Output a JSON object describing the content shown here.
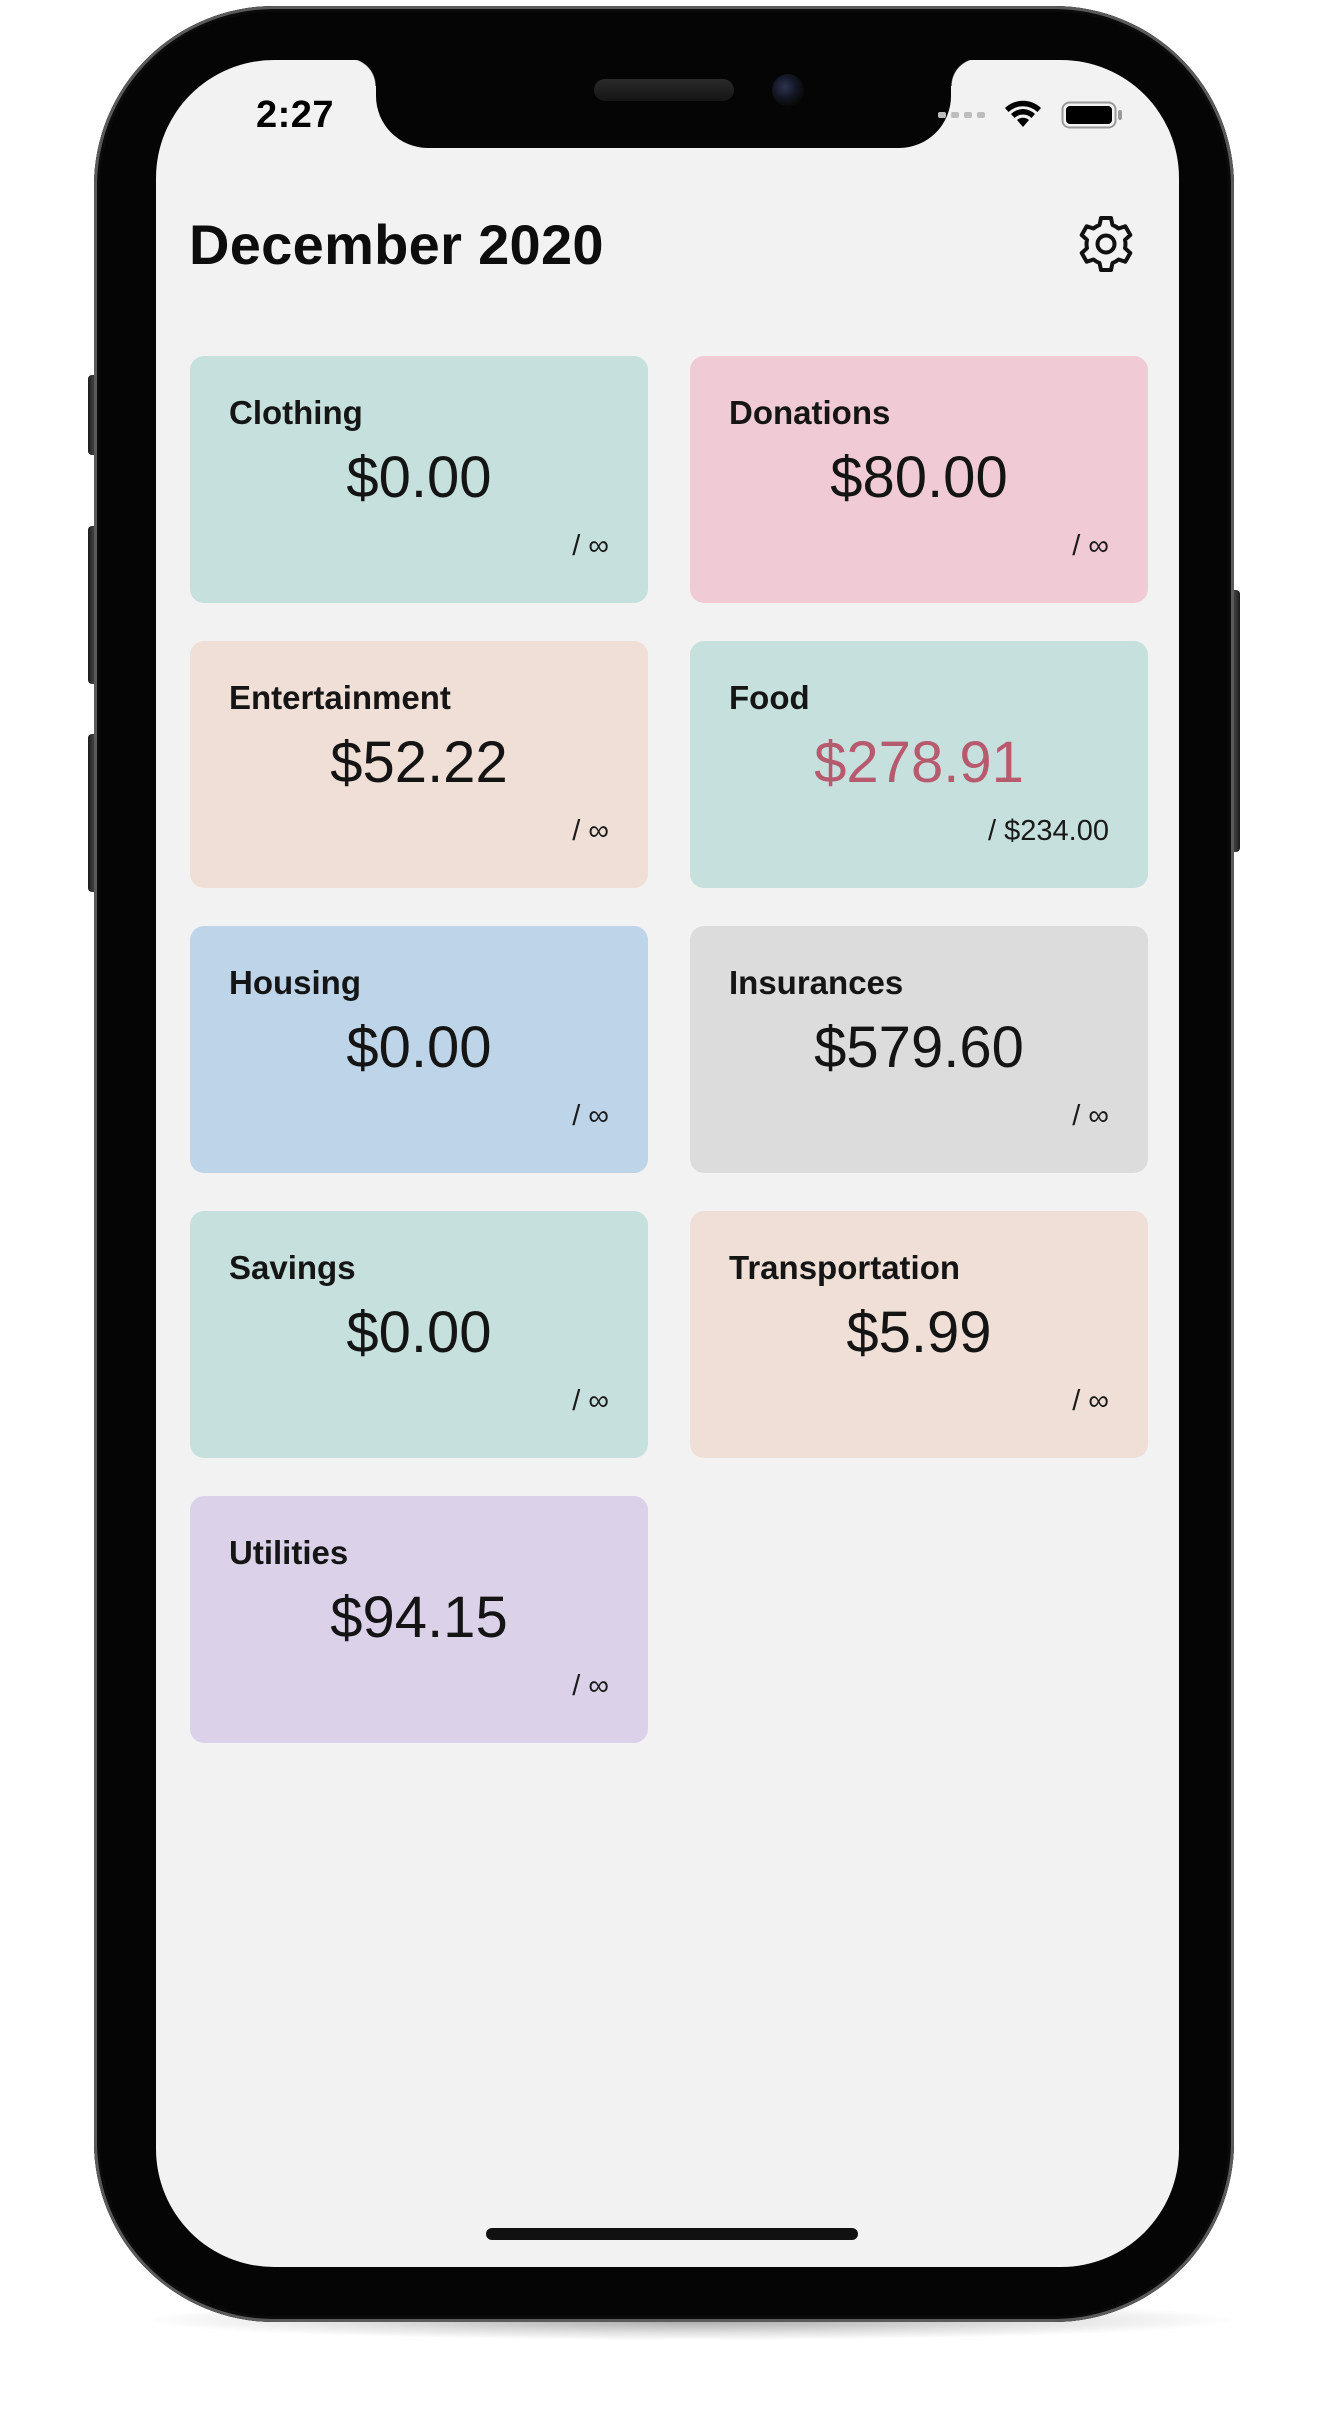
{
  "status_bar": {
    "time": "2:27",
    "icons": [
      "signal-dots-icon",
      "wifi-icon",
      "battery-icon"
    ]
  },
  "header": {
    "title": "December 2020",
    "settings_icon": "gear-icon"
  },
  "colors": {
    "screen_bg": "#f2f2f2",
    "over_budget": "#b85a6e",
    "teal": "#c6e0dd",
    "pink": "#f0cad5",
    "peach": "#efdfd6",
    "blue": "#bed4e8",
    "gray": "#dcdcdc",
    "lavender": "#dbd2ea"
  },
  "categories": [
    {
      "name": "Clothing",
      "amount": "$0.00",
      "limit": "/ ∞",
      "color": "#c6e0dd",
      "over_budget": false
    },
    {
      "name": "Donations",
      "amount": "$80.00",
      "limit": "/ ∞",
      "color": "#f0cad5",
      "over_budget": false
    },
    {
      "name": "Entertainment",
      "amount": "$52.22",
      "limit": "/ ∞",
      "color": "#efdfd6",
      "over_budget": false
    },
    {
      "name": "Food",
      "amount": "$278.91",
      "limit": "/ $234.00",
      "color": "#c6e0dd",
      "over_budget": true
    },
    {
      "name": "Housing",
      "amount": "$0.00",
      "limit": "/ ∞",
      "color": "#bed4e8",
      "over_budget": false
    },
    {
      "name": "Insurances",
      "amount": "$579.60",
      "limit": "/ ∞",
      "color": "#dcdcdc",
      "over_budget": false
    },
    {
      "name": "Savings",
      "amount": "$0.00",
      "limit": "/ ∞",
      "color": "#c6e0dd",
      "over_budget": false
    },
    {
      "name": "Transportation",
      "amount": "$5.99",
      "limit": "/ ∞",
      "color": "#efdfd6",
      "over_budget": false
    },
    {
      "name": "Utilities",
      "amount": "$94.15",
      "limit": "/ ∞",
      "color": "#dbd2ea",
      "over_budget": false
    }
  ]
}
